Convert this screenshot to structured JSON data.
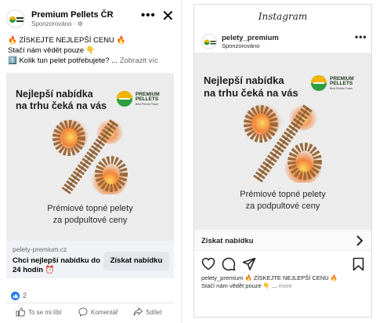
{
  "facebook": {
    "page_name": "Premium Pellets ČR",
    "sponsored_label": "Sponzorováno · ⚙",
    "post_text": {
      "line1": "🔥 ZÍSKEJTE NEJLEPŠÍ CENU 🔥",
      "line2": "Stačí nám vědět pouze 👇",
      "line3_prefix": "1️⃣ Kolik tun pelet potřebujete? ...",
      "see_more": "Zobrazit víc"
    },
    "link": {
      "domain": "pelety-premium.cz",
      "title": "Chci nejlepší nabídku do 24 hodin ⏰",
      "cta": "Získat nabídku"
    },
    "reactions_count": "2",
    "actions": {
      "like": "To se mi líbí",
      "comment": "Komentář",
      "share": "Sdílet"
    }
  },
  "creative": {
    "headline_line1": "Nejlepší nabídka",
    "headline_line2": "na trhu čeká na vás",
    "logo_line1": "PREMIUM",
    "logo_line2": "PELLETS",
    "logo_tagline": "Best Pellets Power",
    "sub_line1": "Prémiové topné pelety",
    "sub_line2": "za podpultové ceny"
  },
  "instagram": {
    "brand": "Instagram",
    "username": "pelety_premium",
    "sponsored_label": "Sponzorováno",
    "cta": "Získat nabídku",
    "caption": {
      "line1": "pelety_premium 🔥 ZÍSKEJTE NEJLEPŠÍ CENU 🔥",
      "line2": "Stačí nám vědět pouze 👇 ...",
      "more": "more"
    }
  },
  "colors": {
    "facebook_blue": "#1877f2",
    "creative_bg": "#ececec",
    "flame_orange": "#f26a10",
    "pellet_brown": "#9a6a3c"
  }
}
